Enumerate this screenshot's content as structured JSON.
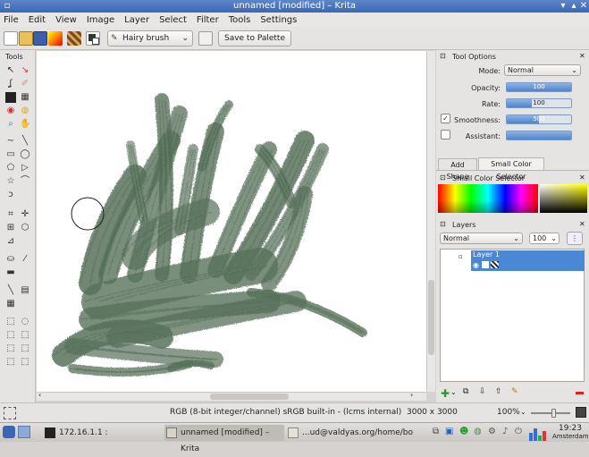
{
  "window": {
    "title": "unnamed [modified] – Krita"
  },
  "menu": [
    "File",
    "Edit",
    "View",
    "Image",
    "Layer",
    "Select",
    "Filter",
    "Tools",
    "Settings"
  ],
  "toolbar": {
    "brush_preset": "Hairy brush",
    "save_to_palette": "Save to Palette"
  },
  "toolbox": {
    "title": "Tools"
  },
  "tool_options": {
    "title": "Tool Options",
    "mode_label": "Mode:",
    "mode_value": "Normal",
    "opacity_label": "Opacity:",
    "opacity_value": "100",
    "opacity_level": 1.0,
    "rate_label": "Rate:",
    "rate_value": "100",
    "rate_level": 0.39,
    "smoothness_label": "Smoothness:",
    "smoothness_value": "500",
    "smoothness_level": 0.5,
    "smoothness_checked": true,
    "assistant_label": "Assistant:",
    "assistant_level": 1.0,
    "assistant_checked": false
  },
  "docker_tabs": [
    "Add Shape",
    "Small Color Selector"
  ],
  "color_selector": {
    "title": "Small Color Selector"
  },
  "layers": {
    "title": "Layers",
    "blend_mode": "Normal",
    "opacity": "100",
    "items": [
      {
        "name": "Layer 1",
        "selected": true
      }
    ]
  },
  "status": {
    "colorspace": "RGB (8-bit integer/channel)  sRGB built-in - (lcms internal)",
    "dimensions": "3000 x 3000",
    "zoom": "100%",
    "zoom_level": 0.6
  },
  "taskbar": {
    "tasks": [
      "172.16.1.1 :",
      "unnamed [modified] – Krita",
      "...ud@valdyas.org/home/bo"
    ],
    "clock_time": "19:23",
    "clock_location": "Amsterdam"
  },
  "colors": {
    "paint": "#4f6a52",
    "accent": "#3d7ad3",
    "titlebar": "#3a66b5"
  }
}
